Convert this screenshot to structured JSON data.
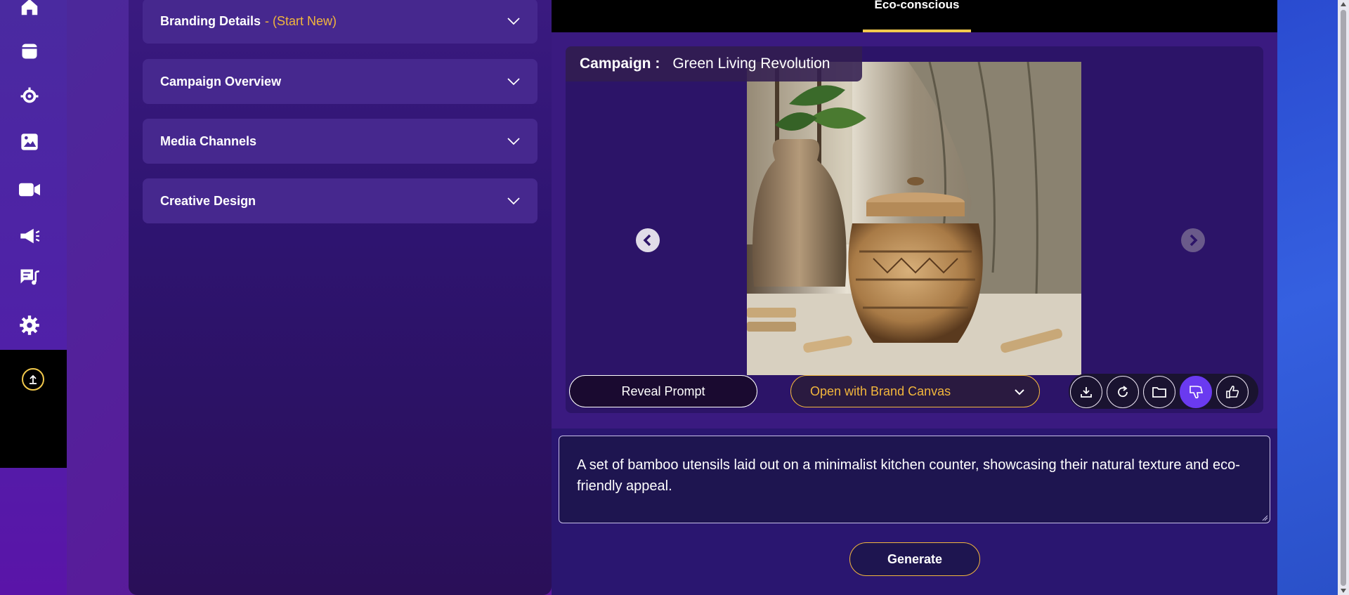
{
  "sidebar": {
    "icons": [
      "home-icon",
      "archive-icon",
      "settings-search-icon",
      "image-icon",
      "video-icon",
      "megaphone-icon",
      "chat-music-icon",
      "gear-icon"
    ],
    "upload_icon": "upload-icon"
  },
  "form": {
    "sections": [
      {
        "label": "Branding Details",
        "tag": "- (Start New)"
      },
      {
        "label": "Campaign Overview",
        "tag": ""
      },
      {
        "label": "Media Channels",
        "tag": ""
      },
      {
        "label": "Creative Design",
        "tag": ""
      }
    ]
  },
  "tabs": {
    "active": "Eco-conscious"
  },
  "viewer": {
    "campaign_key": "Campaign :",
    "campaign_value": "Green Living Revolution",
    "reveal_label": "Reveal Prompt",
    "brand_canvas_label": "Open with Brand Canvas",
    "actions": [
      "download-icon",
      "refresh-icon",
      "folder-icon",
      "thumbs-down-icon",
      "thumbs-up-icon"
    ]
  },
  "prompt": {
    "text": "A set of bamboo utensils laid out on a minimalist kitchen counter, showcasing their natural texture and eco-friendly appeal."
  },
  "generate_label": "Generate",
  "colors": {
    "accent": "#f2b63c",
    "tab_underline": "#f2c94c",
    "active_icon": "#6a3af0"
  }
}
